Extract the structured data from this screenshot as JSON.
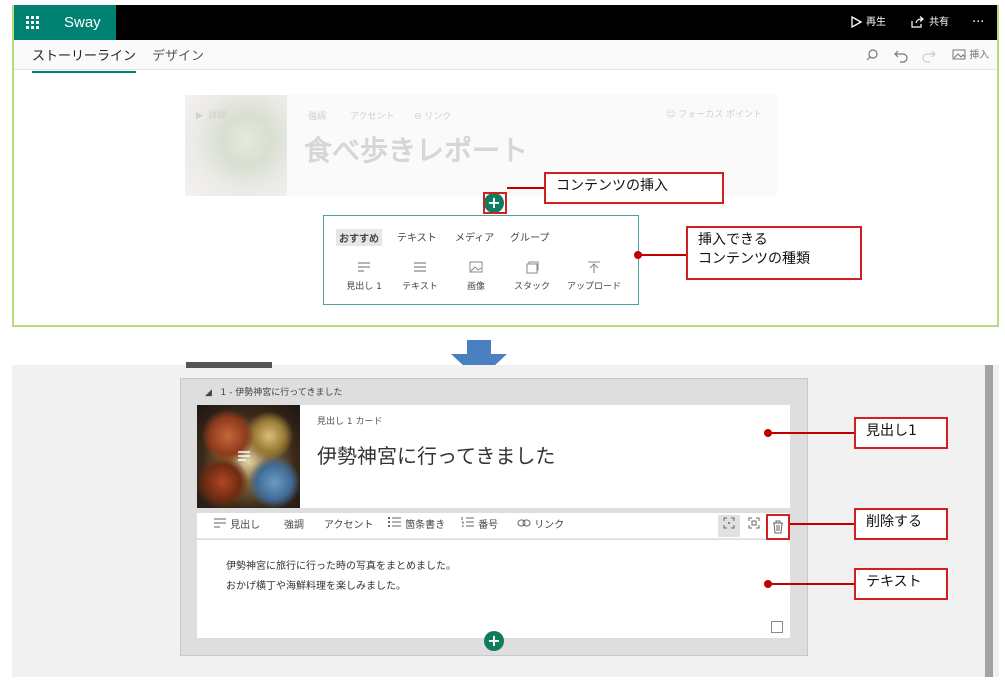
{
  "app": {
    "name": "Sway",
    "play_label": "再生",
    "share_label": "共有",
    "more_label": "···",
    "tabs": [
      "ストーリーライン",
      "デザイン"
    ],
    "insert_label": "挿入"
  },
  "faded_card": {
    "details": "詳細",
    "emphasis": "強調",
    "accent": "アクセント",
    "link": "リンク",
    "focus_point": "フォーカス ポイント",
    "title": "食べ歩きレポート"
  },
  "insert_panel": {
    "tabs": [
      "おすすめ",
      "テキスト",
      "メディア",
      "グループ"
    ],
    "items": [
      {
        "label": "見出し 1",
        "icon": "heading-icon"
      },
      {
        "label": "テキスト",
        "icon": "text-lines-icon"
      },
      {
        "label": "画像",
        "icon": "image-icon"
      },
      {
        "label": "スタック",
        "icon": "stack-icon"
      },
      {
        "label": "アップロード",
        "icon": "upload-icon"
      }
    ]
  },
  "callouts": {
    "insert_content": "コンテンツの挿入",
    "insertable_types_1": "挿入できる",
    "insertable_types_2": "コンテンツの種類",
    "heading1": "見出し1",
    "delete": "削除する",
    "text": "テキスト"
  },
  "bottom": {
    "group_label": "1 - 伊勢神宮に行ってきました",
    "card_label": "見出し 1 カード",
    "card_title": "伊勢神宮に行ってきました",
    "toolbar": {
      "heading": "見出し",
      "emphasis": "強調",
      "accent": "アクセント",
      "bullets": "箇条書き",
      "numbering": "番号",
      "link": "リンク"
    },
    "body": [
      "伊勢神宮に旅行に行った時の写真をまとめました。",
      "おかげ横丁や海鮮料理を楽しみました。"
    ]
  },
  "colors": {
    "brand": "#008272",
    "callout_border": "#d02020",
    "arrow": "#4a7fc0",
    "panel_border": "#b7dc7f"
  }
}
